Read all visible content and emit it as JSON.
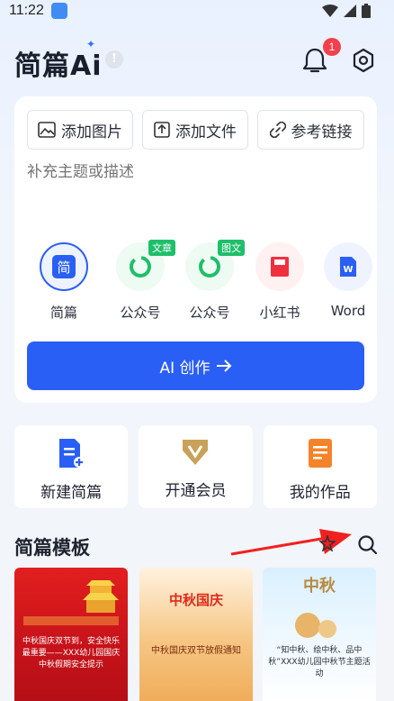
{
  "status": {
    "time": "11:22"
  },
  "header": {
    "logo": "简篇Ai",
    "info_mark": "!",
    "notification_count": "1"
  },
  "attachments": [
    {
      "label": "添加图片",
      "icon": "image-icon"
    },
    {
      "label": "添加文件",
      "icon": "upload-file-icon"
    },
    {
      "label": "参考链接",
      "icon": "link-icon"
    }
  ],
  "prompt": {
    "placeholder": "补充主题或描述"
  },
  "types": [
    {
      "label": "简篇",
      "icon": "jianpian-icon",
      "tag": ""
    },
    {
      "label": "公众号",
      "icon": "wechat-official-icon",
      "tag": "文章"
    },
    {
      "label": "公众号",
      "icon": "wechat-official-icon",
      "tag": "图文"
    },
    {
      "label": "小红书",
      "icon": "xiaohongshu-icon",
      "tag": ""
    },
    {
      "label": "Word",
      "icon": "word-icon",
      "tag": ""
    }
  ],
  "ai_button": {
    "label": "AI 创作"
  },
  "quick_actions": [
    {
      "label": "新建简篇",
      "icon": "new-doc-icon"
    },
    {
      "label": "开通会员",
      "icon": "vip-icon"
    },
    {
      "label": "我的作品",
      "icon": "my-works-icon"
    }
  ],
  "templates": {
    "title": "简篇模板",
    "items": [
      {
        "title": "中秋国庆双节到，安全快乐最重要——XXX幼儿园国庆中秋假期安全提示"
      },
      {
        "badge": "中秋国庆",
        "title": "中秋国庆双节放假通知"
      },
      {
        "badge": "中秋",
        "title": "“知中秋、绘中秋、品中秋”XXX幼儿园中秋节主题活动"
      }
    ]
  },
  "colors": {
    "primary": "#2a5ff5",
    "badge": "#f2404d",
    "tag_green": "#1fbf6a"
  }
}
